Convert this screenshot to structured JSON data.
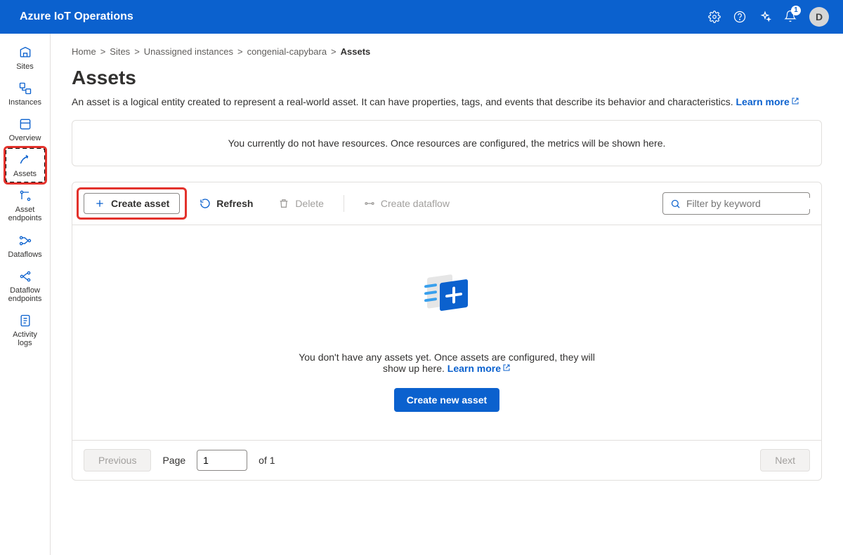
{
  "header": {
    "title": "Azure IoT Operations",
    "notificationCount": "1",
    "avatarInitial": "D"
  },
  "sidebar": {
    "items": [
      {
        "label": "Sites"
      },
      {
        "label": "Instances"
      },
      {
        "label": "Overview"
      },
      {
        "label": "Assets"
      },
      {
        "label": "Asset endpoints"
      },
      {
        "label": "Dataflows"
      },
      {
        "label": "Dataflow endpoints"
      },
      {
        "label": "Activity logs"
      }
    ]
  },
  "breadcrumbs": {
    "items": [
      "Home",
      "Sites",
      "Unassigned instances",
      "congenial-capybara"
    ],
    "current": "Assets",
    "sep": ">"
  },
  "page": {
    "title": "Assets",
    "description": "An asset is a logical entity created to represent a real-world asset. It can have properties, tags, and events that describe its behavior and characteristics.",
    "learnMore": "Learn more"
  },
  "infoCard": {
    "text": "You currently do not have resources. Once resources are configured, the metrics will be shown here."
  },
  "toolbar": {
    "createAsset": "Create asset",
    "refresh": "Refresh",
    "delete": "Delete",
    "createDataflow": "Create dataflow",
    "filterPlaceholder": "Filter by keyword"
  },
  "empty": {
    "line1": "You don't have any assets yet. Once assets are configured, they will show up here.",
    "learnMore": "Learn more",
    "cta": "Create new asset"
  },
  "pager": {
    "prev": "Previous",
    "next": "Next",
    "pageLabel": "Page",
    "pageValue": "1",
    "ofTotal": "of 1"
  }
}
